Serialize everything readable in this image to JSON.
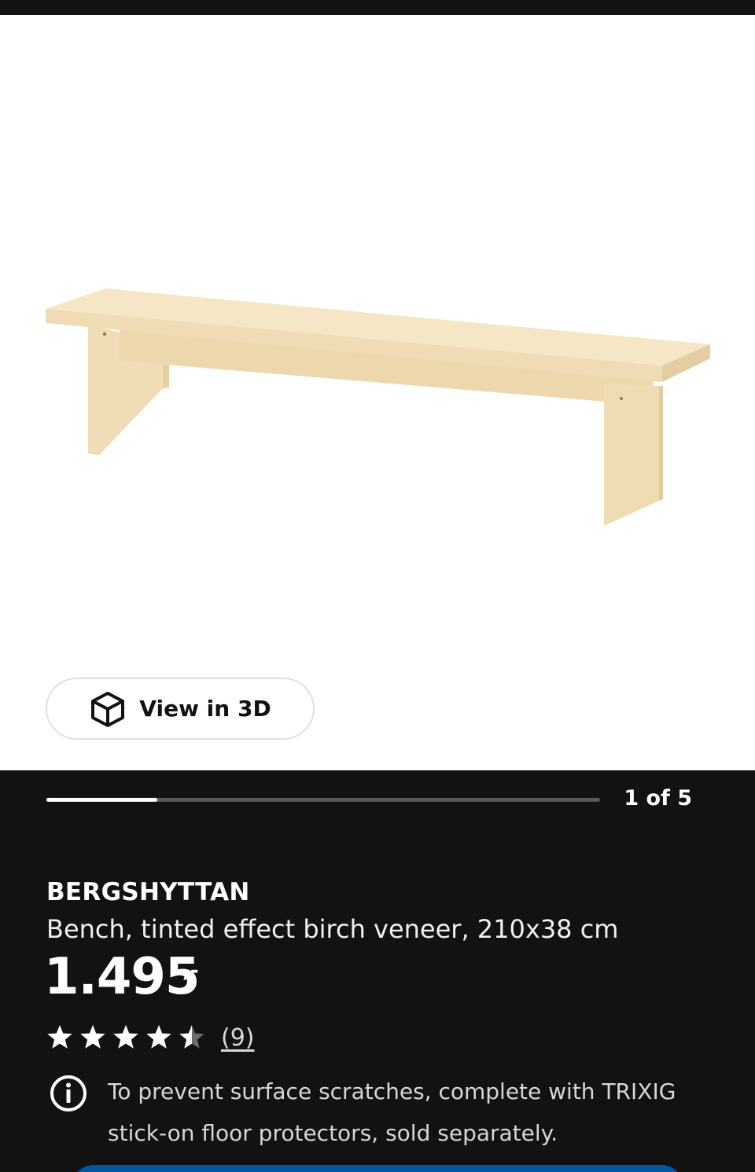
{
  "gallery": {
    "view_3d_label": "View in 3D",
    "view_3d_icon": "cube-icon",
    "counter": "1 of 5",
    "progress": 0.2,
    "image_alt": "BERGSHYTTAN bench"
  },
  "product": {
    "name": "BERGSHYTTAN",
    "description": "Bench, tinted effect birch veneer, 210x38 cm",
    "price": "1.495",
    "price_suffix": ",-",
    "rating": 4.5,
    "rating_max": 5,
    "review_count": "(9)"
  },
  "notice": {
    "icon": "info-icon",
    "text": "To prevent surface scratches, complete with TRIXIG stick-on floor protectors, sold separately."
  },
  "colors": {
    "background": "#121212",
    "wood_light": "#f3e1bf",
    "wood_mid": "#ecd6ad",
    "wood_dark": "#e2c99c",
    "cta_blue": "#0058a3"
  }
}
